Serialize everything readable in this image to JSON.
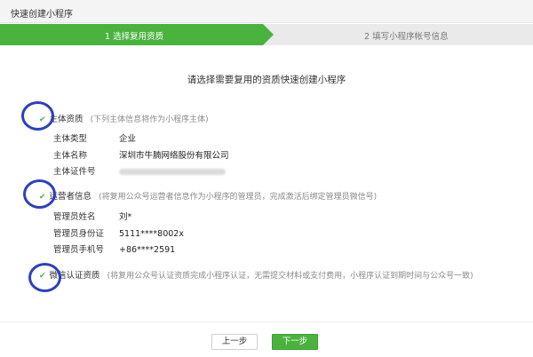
{
  "window": {
    "title": "快速创建小程序"
  },
  "steps": [
    {
      "label": "1 选择复用资质",
      "active": true
    },
    {
      "label": "2 填写小程序帐号信息",
      "active": false
    }
  ],
  "heading": "请选择需要复用的资质快速创建小程序",
  "sections": {
    "subject": {
      "name": "主体资质",
      "note": "(下列主体信息将作为小程序主体)",
      "rows": [
        {
          "label": "主体类型",
          "value": "企业"
        },
        {
          "label": "主体名称",
          "value": "深圳市牛腩网络股份有限公司"
        },
        {
          "label": "主体证件号",
          "value": ""
        }
      ]
    },
    "operator": {
      "name": "运营者信息",
      "note": "(将复用公众号运营者信息作为小程序的管理员，完成激活后绑定管理员微信号)",
      "rows": [
        {
          "label": "管理员姓名",
          "value": "刘*"
        },
        {
          "label": "管理员身份证",
          "value": "5111****8002x"
        },
        {
          "label": "管理员手机号",
          "value": "+86****2591"
        }
      ]
    },
    "cert": {
      "name": "微信认证资质",
      "note": "(将复用公众号认证资质完成小程序认证，无需提交材料或支付费用，小程序认证到期时间与公众号一致)"
    }
  },
  "buttons": {
    "prev": "上一步",
    "next": "下一步"
  },
  "colors": {
    "accent": "#4ab33e",
    "annotation_ring": "#2d3fc4"
  }
}
